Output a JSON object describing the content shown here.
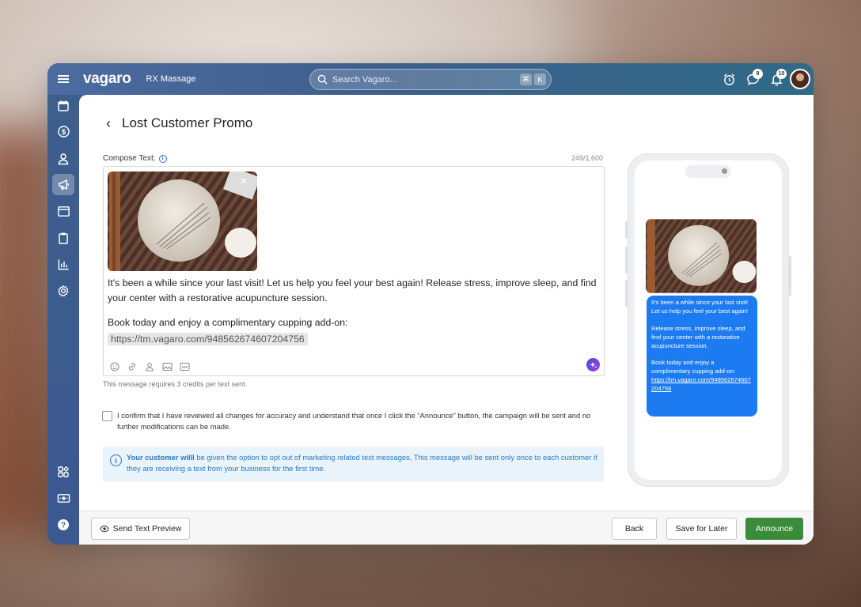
{
  "app": {
    "logo": "vagaro",
    "business_name": "RX Massage"
  },
  "search": {
    "placeholder": "Search Vagaro...",
    "shortcut_keys": [
      "⌘",
      "K"
    ]
  },
  "topbar": {
    "messages_badge": "8",
    "notifications_badge": "10"
  },
  "page": {
    "title": "Lost Customer Promo"
  },
  "compose": {
    "label": "Compose Text:",
    "counter": "249/1,600",
    "body": "It's been a while since your last visit! Let us help you feel your best again! Release stress, improve sleep, and find your center with a restorative acupuncture session.",
    "cta": "Book today and enjoy a complimentary cupping add-on:",
    "link": "https://tm.vagaro.com/948562674607204756",
    "credit_note": "This message requires 3 credits per text sent."
  },
  "confirm": {
    "text": "I confirm that I have reviewed all changes for accuracy and understand that once I click the “Announce” button, the campaign will be sent and no further modifications can be made."
  },
  "notice": {
    "bold": "Your customer willl",
    "text": " be given the option to opt out of marketing related text messages, This message will be sent only once to each customer if they are receiving a text from your business for the first time."
  },
  "preview": {
    "line1": "It's been a while since your last visit! Let us help you feel your best again!",
    "line2": "Release stress, improve sleep, and find your center with a restorative acupuncture session.",
    "line3": "Book today and enjoy a complimentary cupping add-on:",
    "link": "https://tm.vagaro.com/948562674607204756"
  },
  "footer": {
    "send_preview": "Send Text Preview",
    "back": "Back",
    "save_later": "Save for Later",
    "announce": "Announce"
  },
  "colors": {
    "primary_blue": "#3d5f8c",
    "announce_green": "#3b8c3a",
    "bubble_blue": "#1d7bf2",
    "notice_bg": "#e9f3fb"
  }
}
